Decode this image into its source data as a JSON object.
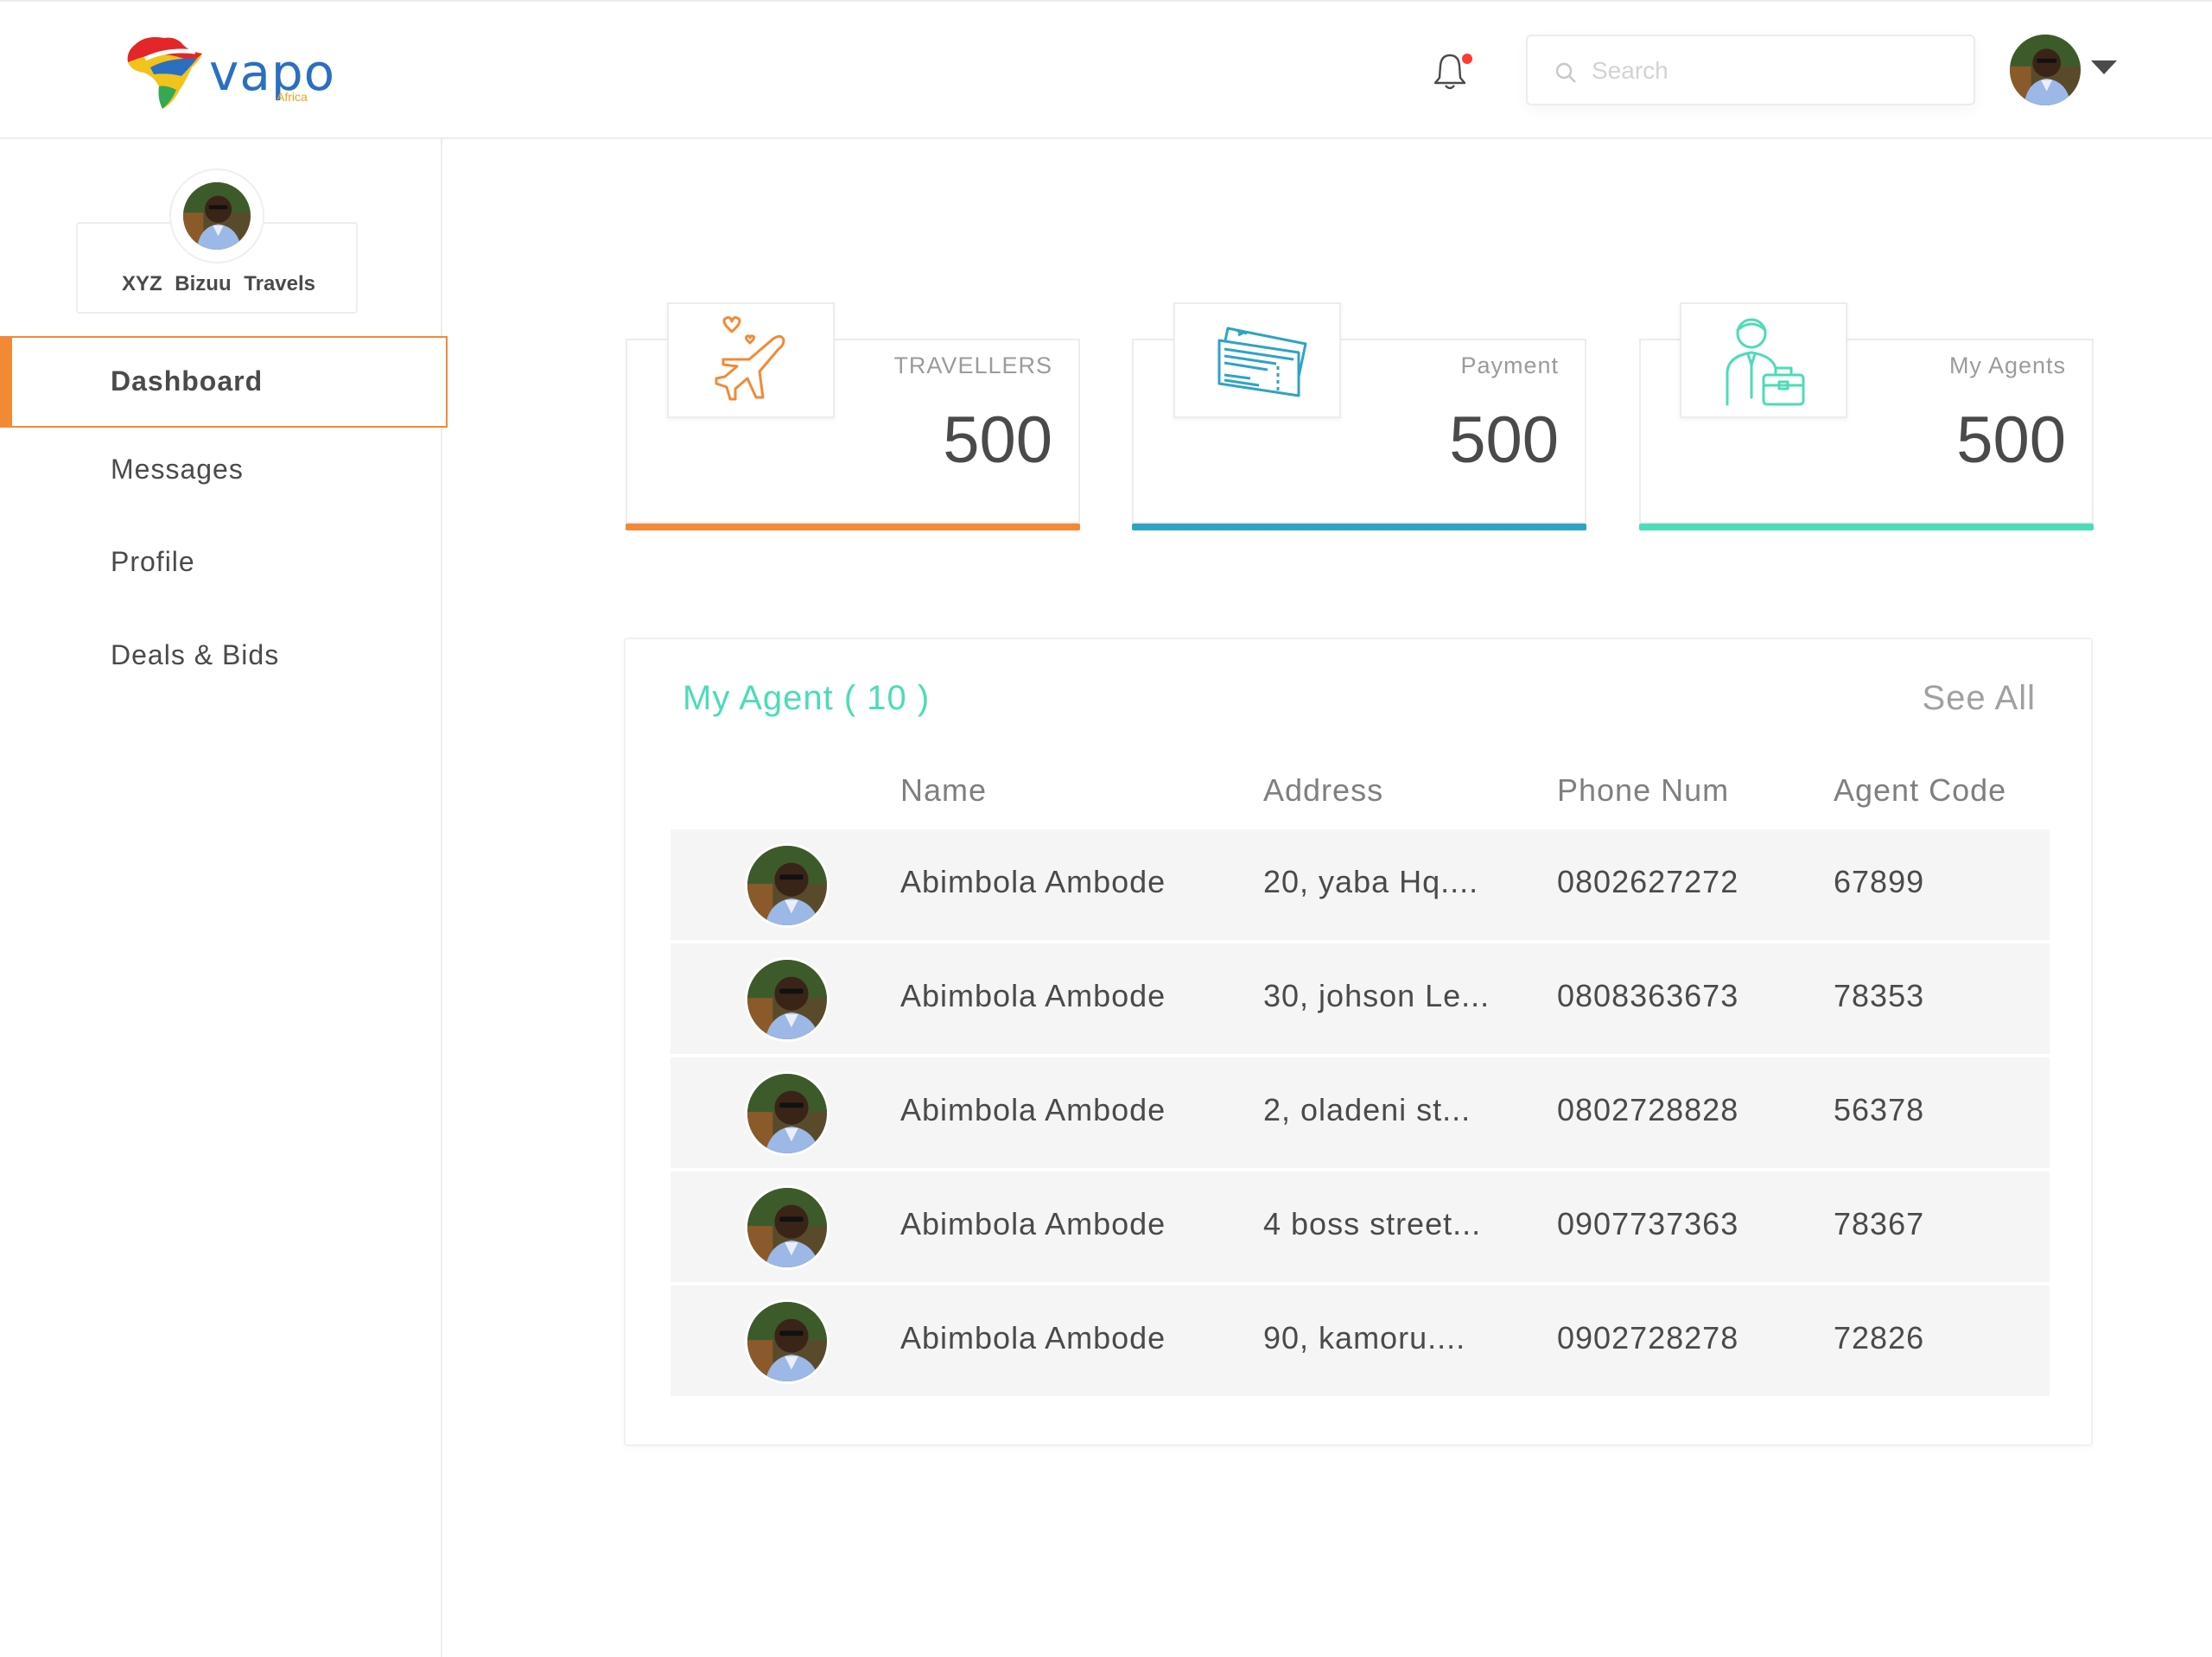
{
  "header": {
    "brand": "vapo",
    "brand_sub": "Africa",
    "search_placeholder": "Search"
  },
  "sidebar": {
    "business_name": "XYZ Bizuu Travels",
    "items": [
      {
        "label": "Dashboard",
        "active": true
      },
      {
        "label": "Messages",
        "active": false
      },
      {
        "label": "Profile",
        "active": false
      },
      {
        "label": "Deals & Bids",
        "active": false
      }
    ]
  },
  "stats": [
    {
      "label": "TRAVELLERS",
      "value": "500",
      "icon": "airplane-icon",
      "accent": "#f28a35"
    },
    {
      "label": "Payment",
      "value": "500",
      "icon": "ticket-icon",
      "accent": "#2fa3c4"
    },
    {
      "label": "My Agents",
      "value": "500",
      "icon": "agent-icon",
      "accent": "#4ddbb8"
    }
  ],
  "agents": {
    "title": "My Agent ( 10 )",
    "see_all": "See All",
    "columns": [
      "Name",
      "Address",
      "Phone Num",
      "Agent Code"
    ],
    "rows": [
      {
        "name": "Abimbola Ambode",
        "address": "20, yaba Hq....",
        "phone": "0802627272",
        "code": "67899"
      },
      {
        "name": "Abimbola Ambode",
        "address": "30, johson Le...",
        "phone": "0808363673",
        "code": "78353"
      },
      {
        "name": "Abimbola Ambode",
        "address": "2, oladeni st...",
        "phone": "0802728828",
        "code": "56378"
      },
      {
        "name": "Abimbola Ambode",
        "address": "4 boss street...",
        "phone": "0907737363",
        "code": "78367"
      },
      {
        "name": "Abimbola Ambode",
        "address": "90, kamoru....",
        "phone": "0902728278",
        "code": "72826"
      }
    ]
  },
  "colors": {
    "accent_orange": "#f28a35",
    "accent_blue": "#2fa3c4",
    "accent_teal": "#4ddbb8",
    "notification_dot": "#ff3b30"
  }
}
